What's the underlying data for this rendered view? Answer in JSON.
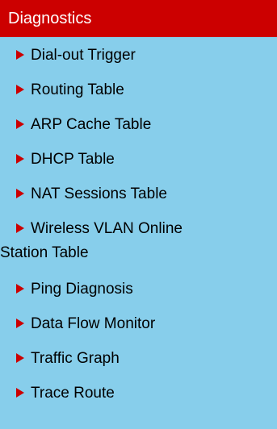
{
  "menu": {
    "title": "Diagnostics",
    "items": [
      {
        "label": "Dial-out Trigger"
      },
      {
        "label": "Routing Table"
      },
      {
        "label": "ARP Cache Table"
      },
      {
        "label": "DHCP Table"
      },
      {
        "label": "NAT Sessions Table"
      },
      {
        "label": "Wireless VLAN Online",
        "label_cont": "Station Table"
      },
      {
        "label": "Ping Diagnosis"
      },
      {
        "label": "Data Flow Monitor"
      },
      {
        "label": "Traffic Graph"
      },
      {
        "label": "Trace Route"
      }
    ]
  },
  "colors": {
    "header_bg": "#cc0000",
    "panel_bg": "#87ceeb",
    "arrow": "#cc0000"
  },
  "icons": {
    "bullet": "triangle-right-icon"
  }
}
